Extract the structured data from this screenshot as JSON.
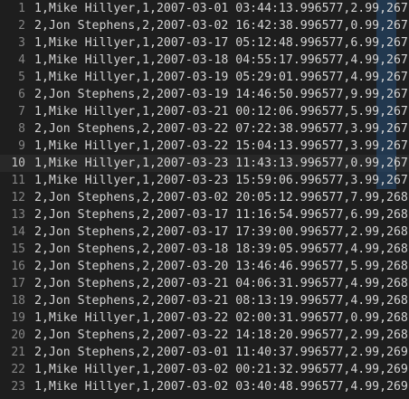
{
  "editor": {
    "active_line": 10,
    "selection_color": "#264f78",
    "lines": [
      {
        "num": "1",
        "text": "1,Mike Hillyer,1,2007-03-01 03:44:13.996577,2.99,267",
        "selected": true
      },
      {
        "num": "2",
        "text": "2,Jon Stephens,2,2007-03-02 16:42:38.996577,0.99,267",
        "selected": true
      },
      {
        "num": "3",
        "text": "1,Mike Hillyer,1,2007-03-17 05:12:48.996577,6.99,267",
        "selected": true
      },
      {
        "num": "4",
        "text": "1,Mike Hillyer,1,2007-03-18 04:55:17.996577,4.99,267",
        "selected": true
      },
      {
        "num": "5",
        "text": "1,Mike Hillyer,1,2007-03-19 05:29:01.996577,4.99,267",
        "selected": true
      },
      {
        "num": "6",
        "text": "2,Jon Stephens,2,2007-03-19 14:46:50.996577,9.99,267",
        "selected": true
      },
      {
        "num": "7",
        "text": "1,Mike Hillyer,1,2007-03-21 00:12:06.996577,5.99,267",
        "selected": true
      },
      {
        "num": "8",
        "text": "2,Jon Stephens,2,2007-03-22 07:22:38.996577,3.99,267",
        "selected": true
      },
      {
        "num": "9",
        "text": "1,Mike Hillyer,1,2007-03-22 15:04:13.996577,3.99,267",
        "selected": true
      },
      {
        "num": "10",
        "text": "1,Mike Hillyer,1,2007-03-23 11:43:13.996577,0.99,267",
        "selected": true
      },
      {
        "num": "11",
        "text": "1,Mike Hillyer,1,2007-03-23 15:59:06.996577,3.99,267",
        "selected": true
      },
      {
        "num": "12",
        "text": "2,Jon Stephens,2,2007-03-02 20:05:12.996577,7.99,268",
        "selected": false
      },
      {
        "num": "13",
        "text": "2,Jon Stephens,2,2007-03-17 11:16:54.996577,6.99,268",
        "selected": false
      },
      {
        "num": "14",
        "text": "2,Jon Stephens,2,2007-03-17 17:39:00.996577,2.99,268",
        "selected": false
      },
      {
        "num": "15",
        "text": "2,Jon Stephens,2,2007-03-18 18:39:05.996577,4.99,268",
        "selected": false
      },
      {
        "num": "16",
        "text": "2,Jon Stephens,2,2007-03-20 13:46:46.996577,5.99,268",
        "selected": false
      },
      {
        "num": "17",
        "text": "2,Jon Stephens,2,2007-03-21 04:06:31.996577,4.99,268",
        "selected": false
      },
      {
        "num": "18",
        "text": "2,Jon Stephens,2,2007-03-21 08:13:19.996577,4.99,268",
        "selected": false
      },
      {
        "num": "19",
        "text": "1,Mike Hillyer,1,2007-03-22 02:00:31.996577,0.99,268",
        "selected": false
      },
      {
        "num": "20",
        "text": "2,Jon Stephens,2,2007-03-22 14:18:20.996577,2.99,268",
        "selected": false
      },
      {
        "num": "21",
        "text": "2,Jon Stephens,2,2007-03-01 11:40:37.996577,2.99,269",
        "selected": false
      },
      {
        "num": "22",
        "text": "1,Mike Hillyer,1,2007-03-02 00:21:32.996577,4.99,269",
        "selected": false
      },
      {
        "num": "23",
        "text": "1,Mike Hillyer,1,2007-03-02 03:40:48.996577,4.99,269",
        "selected": false
      }
    ]
  }
}
